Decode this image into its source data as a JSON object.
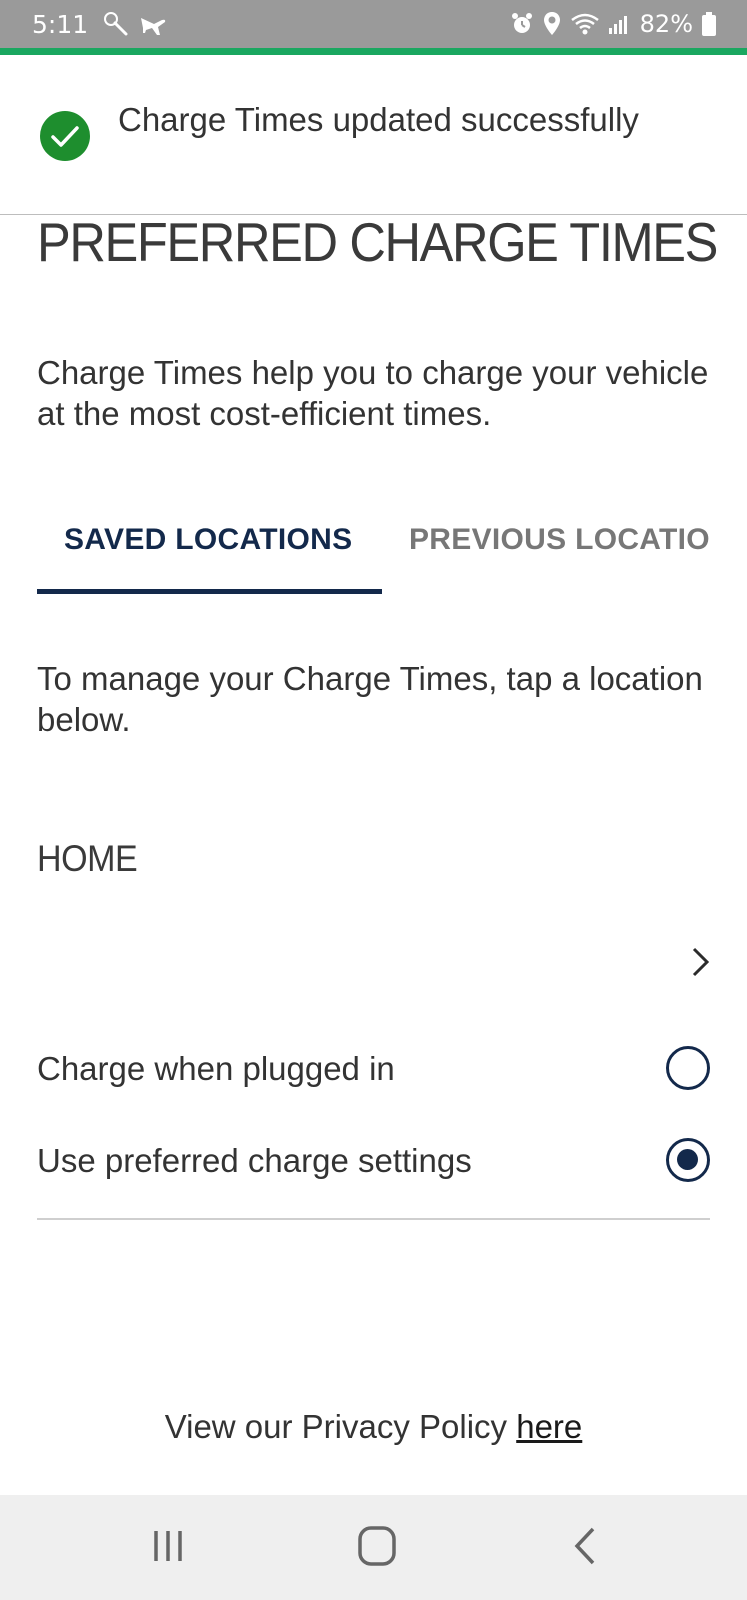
{
  "status_bar": {
    "time": "5:11",
    "battery_percent": "82%",
    "icons": [
      "wrench-search-icon",
      "airplane-icon",
      "alarm-icon",
      "location-pin-icon",
      "wifi-icon",
      "signal-icon",
      "battery-icon"
    ]
  },
  "toast": {
    "message": "Charge Times updated successfully",
    "icon": "check-circle-icon",
    "color": "#1e8e2e"
  },
  "page": {
    "title": "PREFERRED CHARGE TIMES",
    "intro": "Charge Times help you to charge your vehicle at the most cost-efficient times."
  },
  "tabs": [
    {
      "label": "SAVED LOCATIONS",
      "active": true
    },
    {
      "label": "PREVIOUS LOCATIO",
      "active": false
    }
  ],
  "instructions": "To manage your Charge Times, tap a location below.",
  "location": {
    "name": "HOME",
    "options": [
      {
        "label": "Charge when plugged in",
        "selected": false
      },
      {
        "label": "Use preferred charge settings",
        "selected": true
      }
    ]
  },
  "footer": {
    "privacy_text": "View our Privacy Policy ",
    "privacy_link": "here"
  },
  "colors": {
    "accent": "#1aa760",
    "brand_navy": "#13294b",
    "status_bar": "#9a9a9a"
  },
  "nav": {
    "icons": [
      "recent-apps-icon",
      "home-icon",
      "back-icon"
    ]
  }
}
